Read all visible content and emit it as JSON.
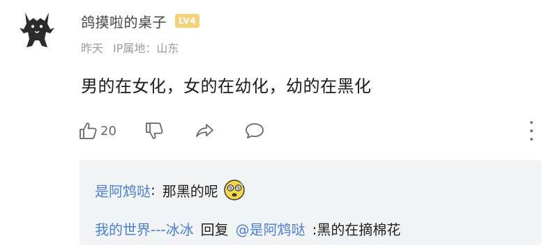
{
  "comment": {
    "username": "鸽摸啦的桌子",
    "level": "LV4",
    "time": "昨天",
    "ip_location": "IP属地：山东",
    "text": "男的在女化，女的在幼化，幼的在黑化",
    "likes": "20",
    "icons": [
      "thumb-up-icon",
      "thumb-down-icon",
      "share-icon",
      "comment-icon",
      "more-icon"
    ]
  },
  "replies": [
    {
      "author": "是阿鸩哒",
      "separator": ":",
      "text": "那黑的呢",
      "emoji": "dizzy-face-emoji"
    },
    {
      "author": "我的世界---冰冰",
      "action": "回复",
      "mention": "@是阿鸩哒",
      "text": ":黑的在摘棉花"
    }
  ],
  "colors": {
    "link": "#4a7fd6",
    "badge": "#f4d27a",
    "reply_bg": "#f3f4f5",
    "meta": "#9a9a9a"
  }
}
